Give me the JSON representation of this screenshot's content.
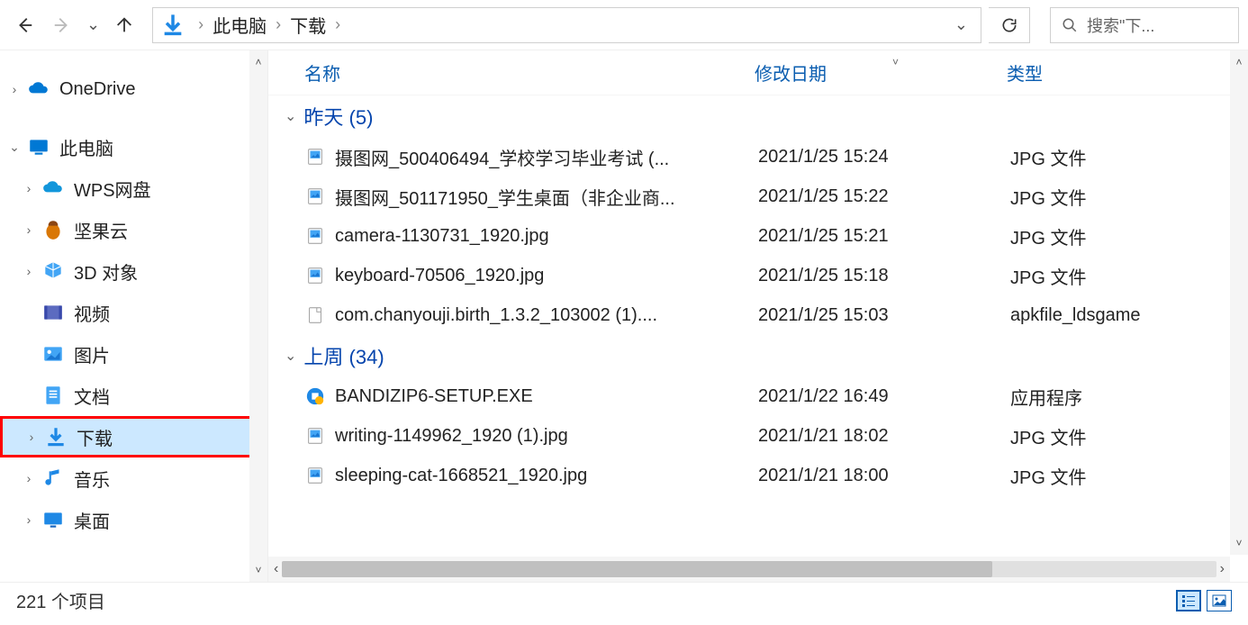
{
  "toolbar": {
    "breadcrumb": [
      "此电脑",
      "下载"
    ],
    "search_placeholder": "搜索\"下..."
  },
  "sidebar": {
    "items": [
      {
        "label": "OneDrive",
        "chev": "›",
        "indent": 0,
        "icon": "onedrive"
      },
      {
        "label": "此电脑",
        "chev": "⌄",
        "indent": 0,
        "icon": "pc"
      },
      {
        "label": "WPS网盘",
        "chev": "›",
        "indent": 1,
        "icon": "wps"
      },
      {
        "label": "坚果云",
        "chev": "›",
        "indent": 1,
        "icon": "nut"
      },
      {
        "label": "3D 对象",
        "chev": "›",
        "indent": 1,
        "icon": "3d"
      },
      {
        "label": "视频",
        "chev": "",
        "indent": 1,
        "icon": "video"
      },
      {
        "label": "图片",
        "chev": "",
        "indent": 1,
        "icon": "picture"
      },
      {
        "label": "文档",
        "chev": "",
        "indent": 1,
        "icon": "doc"
      },
      {
        "label": "下载",
        "chev": "›",
        "indent": 1,
        "icon": "download",
        "selected": true
      },
      {
        "label": "音乐",
        "chev": "›",
        "indent": 1,
        "icon": "music"
      },
      {
        "label": "桌面",
        "chev": "›",
        "indent": 1,
        "icon": "desktop"
      }
    ]
  },
  "columns": {
    "name": "名称",
    "date": "修改日期",
    "type": "类型"
  },
  "groups": [
    {
      "label": "昨天 (5)",
      "files": [
        {
          "name": "摄图网_500406494_学校学习毕业考试 (...",
          "date": "2021/1/25 15:24",
          "type": "JPG 文件",
          "icon": "jpg"
        },
        {
          "name": "摄图网_501171950_学生桌面（非企业商...",
          "date": "2021/1/25 15:22",
          "type": "JPG 文件",
          "icon": "jpg"
        },
        {
          "name": "camera-1130731_1920.jpg",
          "date": "2021/1/25 15:21",
          "type": "JPG 文件",
          "icon": "jpg"
        },
        {
          "name": "keyboard-70506_1920.jpg",
          "date": "2021/1/25 15:18",
          "type": "JPG 文件",
          "icon": "jpg"
        },
        {
          "name": "com.chanyouji.birth_1.3.2_103002 (1)....",
          "date": "2021/1/25 15:03",
          "type": "apkfile_ldsgame",
          "icon": "file"
        }
      ]
    },
    {
      "label": "上周 (34)",
      "files": [
        {
          "name": "BANDIZIP6-SETUP.EXE",
          "date": "2021/1/22 16:49",
          "type": "应用程序",
          "icon": "exe"
        },
        {
          "name": "writing-1149962_1920 (1).jpg",
          "date": "2021/1/21 18:02",
          "type": "JPG 文件",
          "icon": "jpg"
        },
        {
          "name": "sleeping-cat-1668521_1920.jpg",
          "date": "2021/1/21 18:00",
          "type": "JPG 文件",
          "icon": "jpg"
        }
      ]
    }
  ],
  "status": {
    "count_label": "221 个项目"
  }
}
